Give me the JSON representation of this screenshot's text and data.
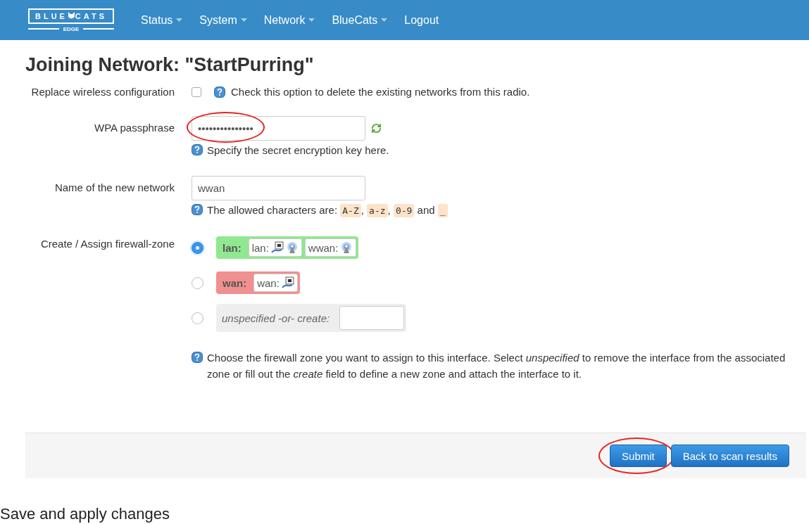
{
  "navbar": {
    "logo": {
      "left": "BLUE",
      "right": "CATS",
      "sub": "EDGE"
    },
    "menu": [
      {
        "label": "Status",
        "dropdown": true
      },
      {
        "label": "System",
        "dropdown": true
      },
      {
        "label": "Network",
        "dropdown": true
      },
      {
        "label": "BlueCats",
        "dropdown": true
      },
      {
        "label": "Logout",
        "dropdown": false
      }
    ]
  },
  "title": "Joining Network: \"StartPurring\"",
  "form": {
    "replace": {
      "label": "Replace wireless configuration",
      "checked": false,
      "hint": "Check this option to delete the existing networks from this radio."
    },
    "passphrase": {
      "label": "WPA passphrase",
      "value": "•••••••••••••••",
      "highlighted": true,
      "hint": "Specify the secret encryption key here."
    },
    "name": {
      "label": "Name of the new network",
      "value": "wwan",
      "hint_parts": [
        {
          "kind": "text",
          "text": "The allowed characters are: "
        },
        {
          "kind": "code",
          "text": "A-Z"
        },
        {
          "kind": "text",
          "text": ", "
        },
        {
          "kind": "code",
          "text": "a-z"
        },
        {
          "kind": "text",
          "text": ", "
        },
        {
          "kind": "code",
          "text": "0-9"
        },
        {
          "kind": "text",
          "text": " and "
        },
        {
          "kind": "code",
          "text": "_"
        }
      ]
    },
    "firewall": {
      "label": "Create / Assign firewall-zone",
      "options": [
        {
          "kind": "zone",
          "selected": true,
          "name": "lan:",
          "color": "#90e890",
          "networks": [
            {
              "name": "lan:",
              "icons": [
                {
                  "kind": "ethernet"
                },
                {
                  "kind": "wireless"
                }
              ]
            },
            {
              "name": "wwan:",
              "icons": [
                {
                  "kind": "wireless"
                }
              ]
            }
          ]
        },
        {
          "kind": "zone",
          "selected": false,
          "name": "wan:",
          "color": "#f09090",
          "networks": [
            {
              "name": "wan:",
              "icons": [
                {
                  "kind": "ethernet"
                }
              ]
            }
          ]
        },
        {
          "kind": "create",
          "selected": false,
          "name": "unspecified -or- create:"
        }
      ],
      "hint": "Choose the firewall zone you want to assign to this interface. Select *unspecified* to remove the interface from the associated zone or fill out the *create* field to define a new zone and attach the interface to it."
    }
  },
  "actions": [
    {
      "label": "Submit",
      "highlighted": true
    },
    {
      "label": "Back to scan results",
      "highlighted": false
    }
  ],
  "caption": "Save and apply changes"
}
